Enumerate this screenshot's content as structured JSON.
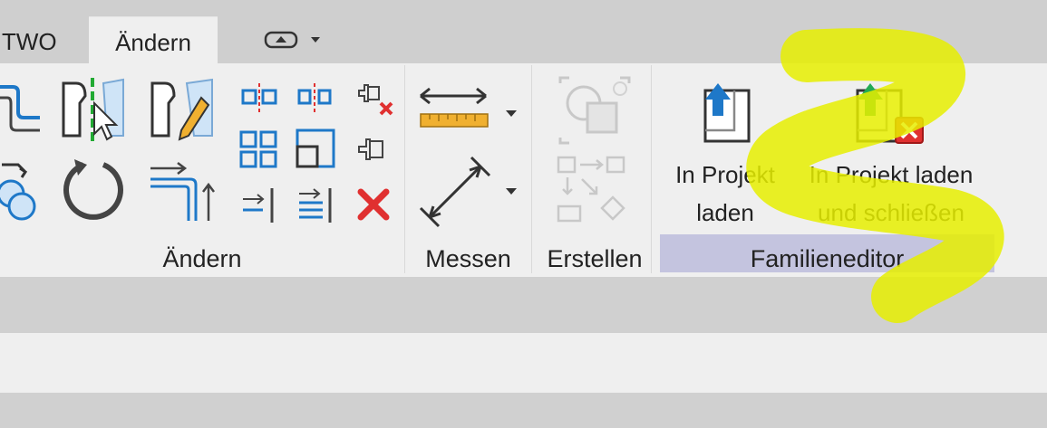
{
  "tabs": {
    "partial": "TWO",
    "active": "Ändern"
  },
  "panels": {
    "modify": "Ändern",
    "measure": "Messen",
    "create": "Erstellen",
    "family_editor": "Familieneditor"
  },
  "buttons": {
    "load_into_project": {
      "line1": "In Projekt",
      "line2": "laden"
    },
    "load_and_close": {
      "line1": "In Projekt laden",
      "line2": "und schließen"
    }
  },
  "colors": {
    "ribbon": "#efefef",
    "tabbar": "#cfcfcf",
    "panel_highlight": "#c4c4df",
    "marker": "#e6ee00",
    "icon_blue": "#1e78c8",
    "delete_red": "#e03030"
  },
  "icons": [
    "align-icon",
    "offset-icon",
    "mirror-pick-axis-icon",
    "mirror-draw-axis-icon",
    "move-icon",
    "copy-icon",
    "rotate-icon",
    "trim-extend-icon",
    "split-icon",
    "array-icon",
    "scale-icon",
    "pin-icon",
    "unpin-icon",
    "delete-icon",
    "aligned-dimension-icon",
    "angular-dimension-icon",
    "create-similar-icon",
    "create-group-icon",
    "load-into-project-icon",
    "load-and-close-icon"
  ]
}
